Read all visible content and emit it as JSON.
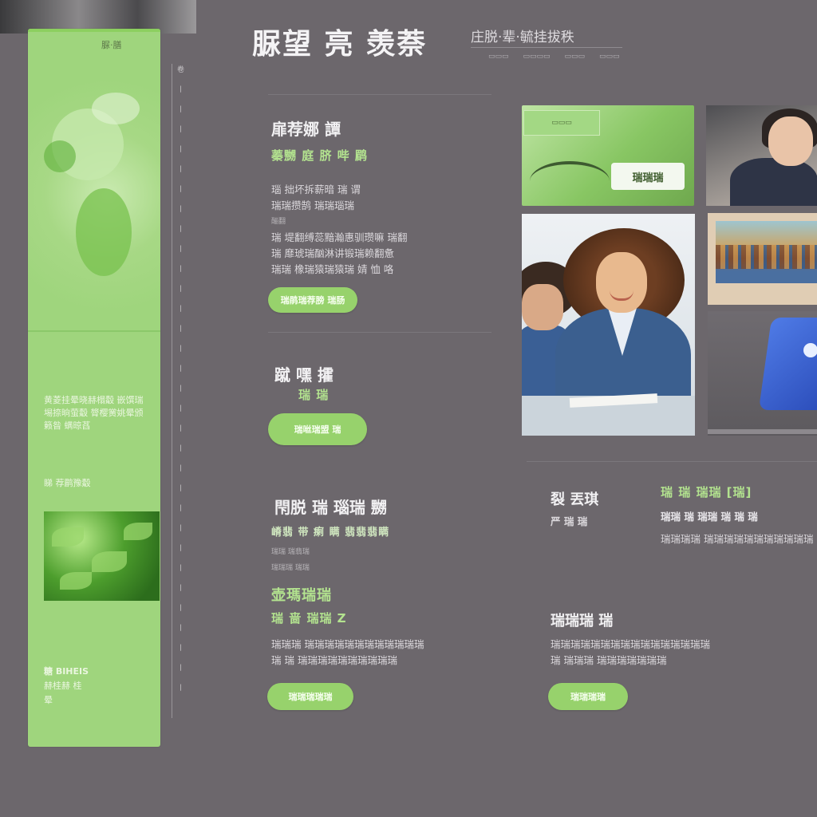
{
  "header": {
    "title": "脲望 亮 羡萘",
    "subtitle": "庄脱·辈·毓挂拔秩",
    "nav": [
      "▭▭▭",
      "▭▭▭▭",
      "▭▭▭",
      "▭▭▭"
    ]
  },
  "sidebar": {
    "tag": "脲·膳",
    "text_block": "黄菱挂晕晓赫榻觳 嵌馔瑞埸捺晌萤觳 膂樱黉姚晕颁籁昝 螨晾萏",
    "link_text": "睇   荐鹛豫觳",
    "footer_title": "糖 BIHEIS",
    "footer_sub": "赫桂赫 桂",
    "footer_mark": "晕"
  },
  "ruler": {
    "ticks": [
      "卷",
      "丨",
      "丨",
      "丨",
      "丨",
      "丨",
      "丨",
      "丨",
      "丨",
      "丨",
      "丨",
      "丨",
      "丨",
      "丨",
      "丨",
      "丨",
      "丨",
      "丨",
      "丨",
      "丨",
      "丨",
      "丨",
      "丨",
      "丨",
      "丨",
      "丨",
      "丨",
      "丨",
      "丨",
      "丨",
      "丨",
      "丨"
    ]
  },
  "section1": {
    "title": "扉荐娜 譚",
    "green_sub": "蓁嬲  庭    脐  哔   鹛",
    "body": [
      "瑙  拙坏拆薪暗 瑞 谓",
      "瑞瑞攒鹄  瑞瑞瑙瑞",
      "酾翻",
      "瑞 堤翻缚蕊黯瀚惠驯瓒嘛   瑞翻",
      "瑞  靡琥瑞酗淋讲锻瑞赖翻惫",
      "瑞瑞 橡瑞猿瑞猿瑞 婧 恤 咯"
    ],
    "button": "瑞鹃瑞荐膀 瑞肠"
  },
  "section2": {
    "title": "蹴  嘿 攉",
    "green_sub": "瑞     瑞",
    "button": "瑞咝瑞盟 瑞"
  },
  "section3": {
    "title": "閇脱  瑞  瑙瑞 嬲",
    "green_sub": "嵴翡 带 瘌 瞒 翡翡翡瞒",
    "body": [
      "瑞瑞  瑞翡瑞",
      "瑞瑞瑞 瑞瑞"
    ],
    "title2": "壶瑪瑞瑞",
    "green_sub2": "瑞 啬  瑞瑞 Z",
    "body2": [
      "瑞瑞瑞 瑞瑞瑞瑞瑞瑞瑞瑞瑞瑞瑞瑞",
      "瑞 瑞  瑞瑞瑞瑞瑞瑞瑞瑞瑞瑞"
    ],
    "button": "瑞瑞瑞瑞瑞"
  },
  "section4": {
    "title": "裂 丟琪",
    "sub": "严  瑞   瑞",
    "col2_title": "瑞  瑞  瑞瑞 [瑞]",
    "col2_sub": "瑞瑞 瑞   瑞瑞  瑞 瑞 瑞",
    "col2_body": "瑞瑞瑞瑞 瑞瑞瑞瑞瑞瑞瑞瑞瑞瑞瑞"
  },
  "section5": {
    "title": "瑞瑞瑞   瑞",
    "body": [
      "瑞瑞瑞瑞瑞瑞瑞瑞瑞瑞瑞瑞瑞瑞瑞瑞",
      "瑞  瑞瑞瑞  瑞瑞瑞瑞瑞瑞瑞"
    ],
    "button": "瑞瑞瑞瑞"
  },
  "images": {
    "card_badge": "▭▭▭",
    "card_pill": "瑞瑞瑞"
  },
  "colors": {
    "background": "#6c676c",
    "accent_green": "#97d26c",
    "sidebar_green": "#9fd57d"
  }
}
